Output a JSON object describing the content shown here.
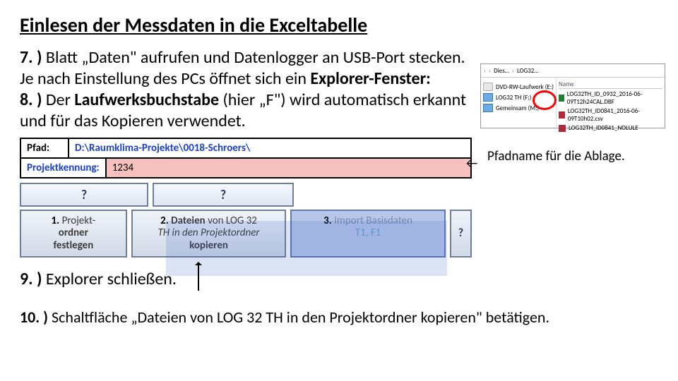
{
  "title": "Einlesen der Messdaten in die Exceltabelle",
  "para": {
    "s7_lead": "7. )",
    "s7_rest": " Blatt „Daten\" aufrufen und Datenlogger an USB-Port stecken. Je nach Einstellung des PCs öffnet sich ein ",
    "s7_bold2": "Explorer-Fenster:",
    "s8_lead": "8. )",
    "s8_rest_a": " Der ",
    "s8_bold": "Laufwerksbuchstabe",
    "s8_rest_b": " (hier „F\") wird automatisch erkannt und für das Kopieren verwendet."
  },
  "explorer": {
    "crumb1": "Dies…",
    "crumb2": "LOG32…",
    "name_hdr": "Name",
    "drive_e": "DVD-RW-Laufwerk (E:)",
    "drive_f": "LOG32 TH (F:)",
    "drive_m": "Gemeinsam (M:)",
    "file1": "LOG32TH_ID_0932_2016-06-09T12h24CAL.DBF",
    "file2": "LOG32TH_ID0841_2016-06-09T10h02.csv",
    "file3": "LOG32TH_ID0841_NOLULE"
  },
  "sheet": {
    "path_label": "Pfad:",
    "path_value": "D:\\Raumklima-Projekte\\0018-Schroers\\",
    "proj_label": "Projektkennung:",
    "proj_value": "1234",
    "q": "?",
    "btn1_num": "1.",
    "btn1_a": "Projekt-",
    "btn1_b": "ordner",
    "btn1_c": "festlegen",
    "btn2_num": "2.",
    "btn2_a": "Dateien",
    "btn2_b": "von LOG 32",
    "btn2_c": "TH in den Projektordner",
    "btn2_d": "kopieren",
    "btn3_num": "3.",
    "btn3_a": "Import",
    "btn3_b": "Basisdaten",
    "btn3_c": "T1, F1"
  },
  "note_path": "Pfadname für die Ablage.",
  "arrow_left": "←",
  "step9_lead": "9. )",
  "step9_rest": " Explorer schließen.",
  "step10_lead": "10. )",
  "step10_rest_a": " Schaltfläche ",
  "step10_quote": "„Dateien von LOG 32 TH in den Projektordner kopieren\" betätigen."
}
